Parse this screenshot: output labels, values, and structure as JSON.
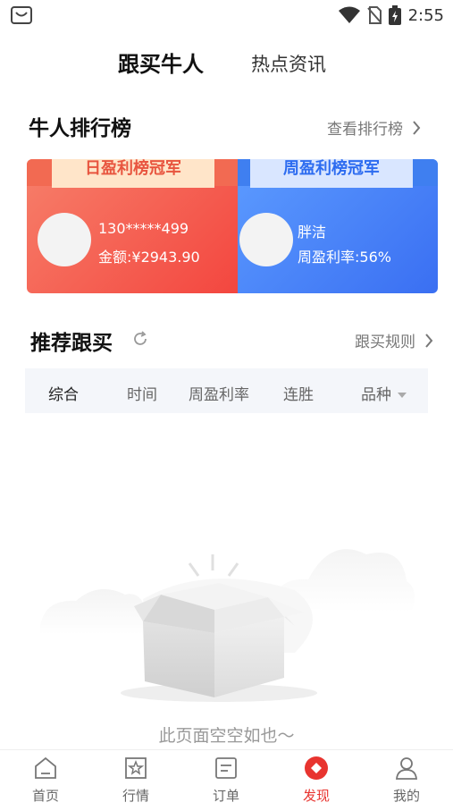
{
  "status_bar": {
    "time": "2:55"
  },
  "top_tabs": [
    {
      "label": "跟买牛人",
      "active": true
    },
    {
      "label": "热点资讯",
      "active": false
    }
  ],
  "ranking": {
    "title": "牛人排行榜",
    "link": "查看排行榜",
    "daily": {
      "ribbon": "日盈利榜冠军",
      "name": "130*****499",
      "stat": "金额:¥2943.90"
    },
    "weekly": {
      "ribbon": "周盈利榜冠军",
      "name": "胖洁",
      "stat": "周盈利率:56%"
    }
  },
  "recommend": {
    "title": "推荐跟买",
    "link": "跟买规则",
    "filters": [
      "综合",
      "时间",
      "周盈利率",
      "连胜",
      "品种"
    ],
    "active_filter": "综合"
  },
  "empty_state": {
    "message": "此页面空空如也～"
  },
  "bottom_nav": [
    {
      "label": "首页",
      "icon": "home-icon"
    },
    {
      "label": "行情",
      "icon": "market-icon"
    },
    {
      "label": "订单",
      "icon": "order-icon"
    },
    {
      "label": "发现",
      "icon": "discover-icon",
      "active": true
    },
    {
      "label": "我的",
      "icon": "profile-icon"
    }
  ],
  "colors": {
    "accent": "#e8342f",
    "gold_bg": "#ffe5c9",
    "blue_bg": "#d9e6ff"
  }
}
